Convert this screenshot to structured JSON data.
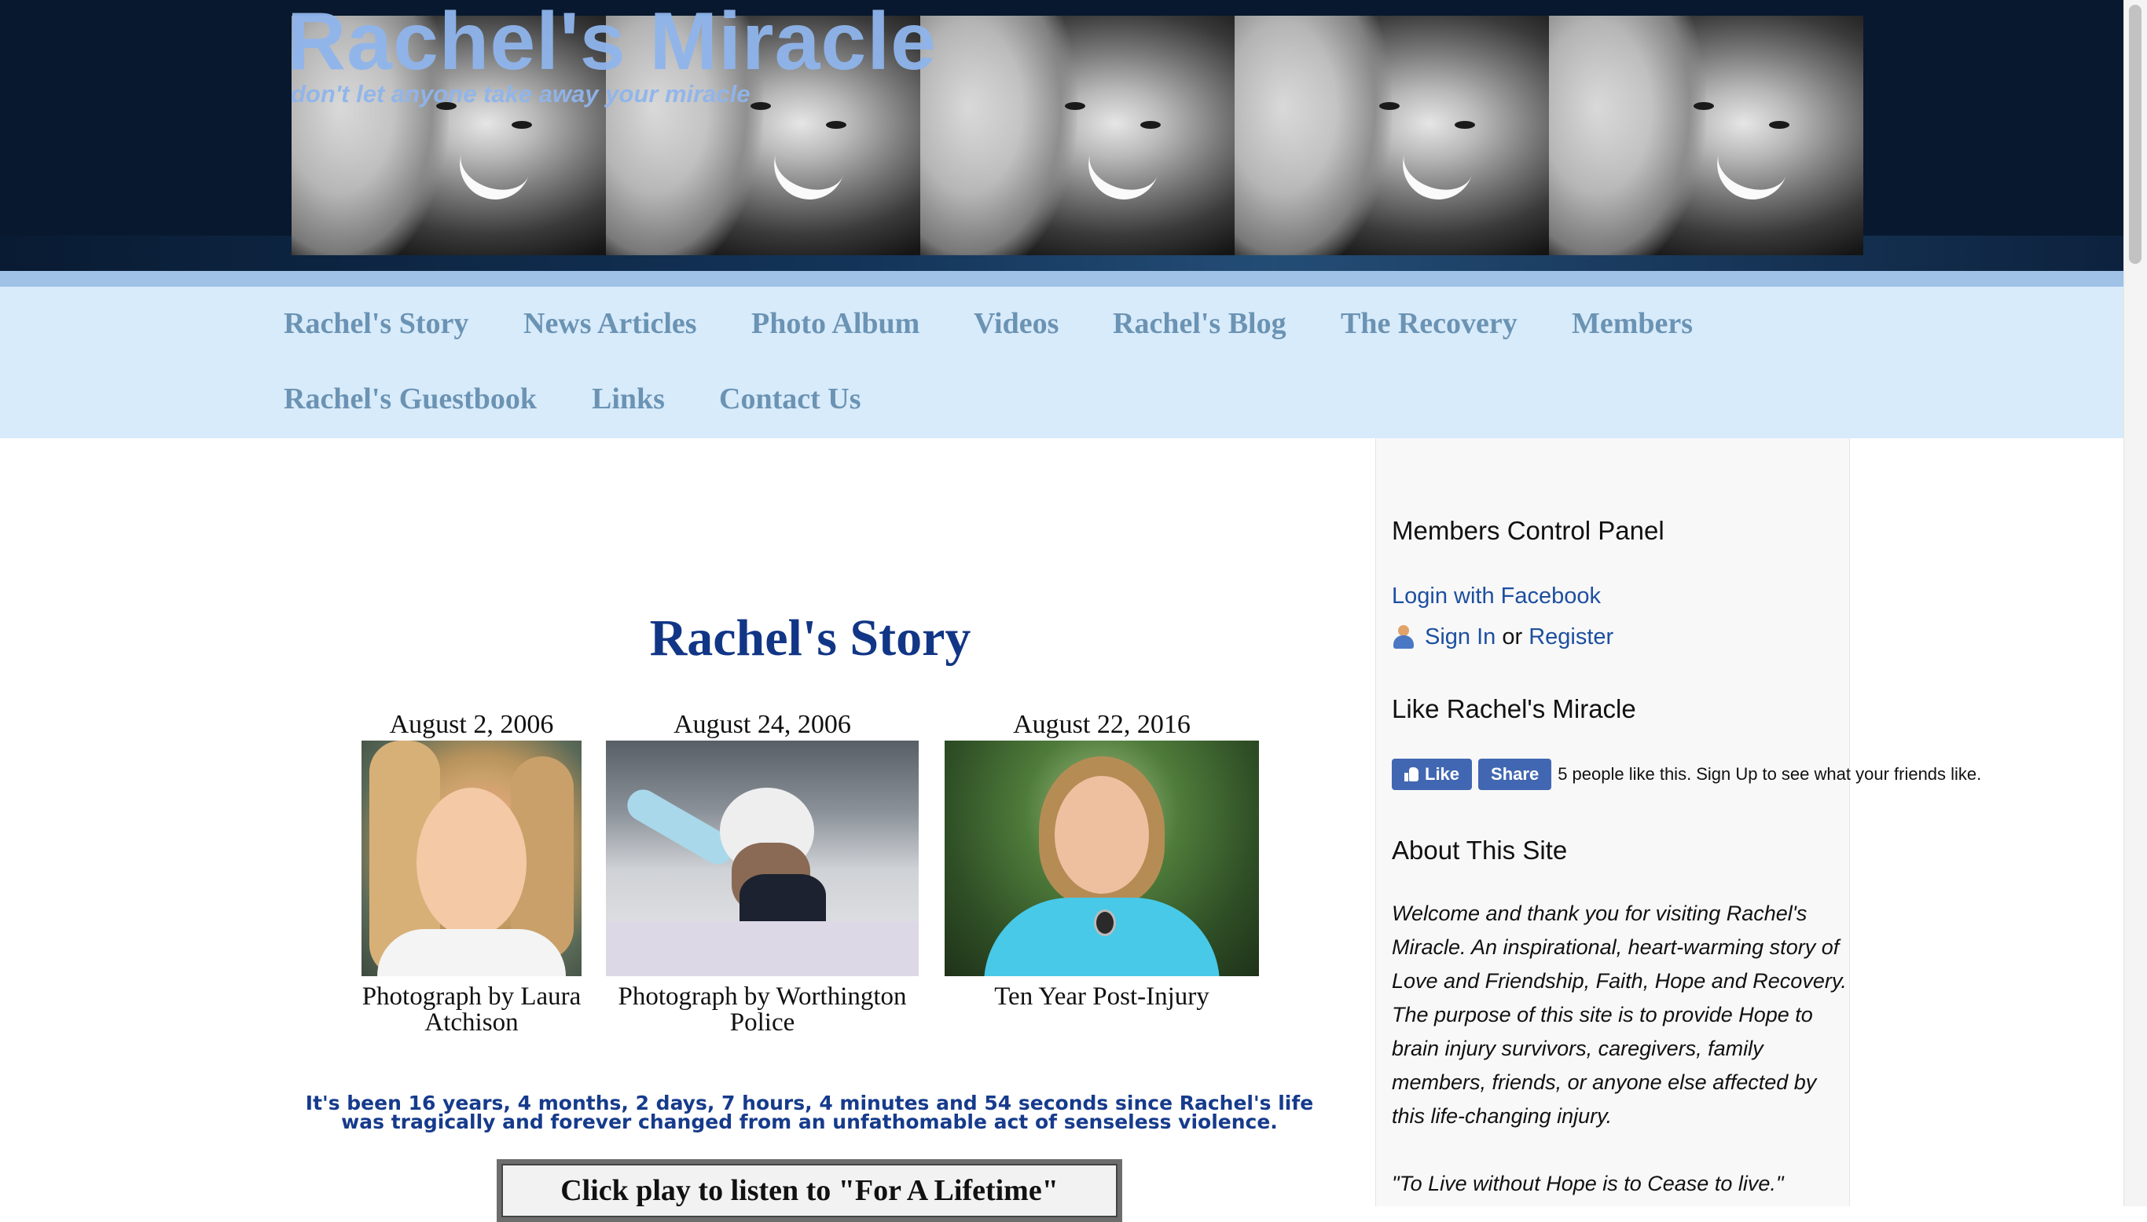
{
  "header": {
    "site_title": "Rachel's Miracle",
    "tagline": "don't let anyone take away your miracle"
  },
  "nav": {
    "items": [
      {
        "label": "Rachel's Story"
      },
      {
        "label": "News Articles"
      },
      {
        "label": "Photo Album"
      },
      {
        "label": "Videos"
      },
      {
        "label": "Rachel's Blog"
      },
      {
        "label": "The Recovery"
      },
      {
        "label": "Members"
      },
      {
        "label": "Rachel's Guestbook"
      },
      {
        "label": "Links"
      },
      {
        "label": "Contact Us"
      }
    ]
  },
  "main": {
    "title": "Rachel's Story",
    "figures": [
      {
        "date": "August 2, 2006",
        "caption": "Photograph by Laura Atchison"
      },
      {
        "date": "August 24, 2006",
        "caption": "Photograph by Worthington Police"
      },
      {
        "date": "August 22, 2016",
        "caption": "Ten Year Post-Injury"
      }
    ],
    "counter_text": "It's been 16 years, 4 months, 2 days, 7 hours, 4 minutes and 54 seconds since Rachel's life was tragically and forever changed from an unfathomable act of senseless violence.",
    "player_label": "Click play to listen to \"For A Lifetime\""
  },
  "sidebar": {
    "members_heading": "Members Control Panel",
    "login_facebook": "Login with Facebook",
    "sign_in": "Sign In",
    "or_text": "or",
    "register": "Register",
    "like_heading": "Like Rachel's Miracle",
    "fb_like": "Like",
    "fb_share": "Share",
    "fb_count_text": "5 people like this.",
    "fb_signup": "Sign Up",
    "fb_suffix": "to see what your friends like.",
    "about_heading": "About This Site",
    "about_text": "Welcome and thank you for visiting Rachel's Miracle. An inspirational, heart-warming story of Love and Friendship, Faith, Hope and Recovery. The purpose of this site is to provide Hope to brain injury survivors, caregivers, family members, friends, or anyone else affected by this life-changing injury.",
    "quote": "\"To Live without Hope is to Cease to live.\""
  },
  "colors": {
    "banner_bg": "#08182e",
    "nav_bg": "#d8ebfb",
    "nav_text": "#6b93b3",
    "title_blue": "#123686",
    "link_blue": "#1d4fa0",
    "facebook_blue": "#4267b2"
  }
}
